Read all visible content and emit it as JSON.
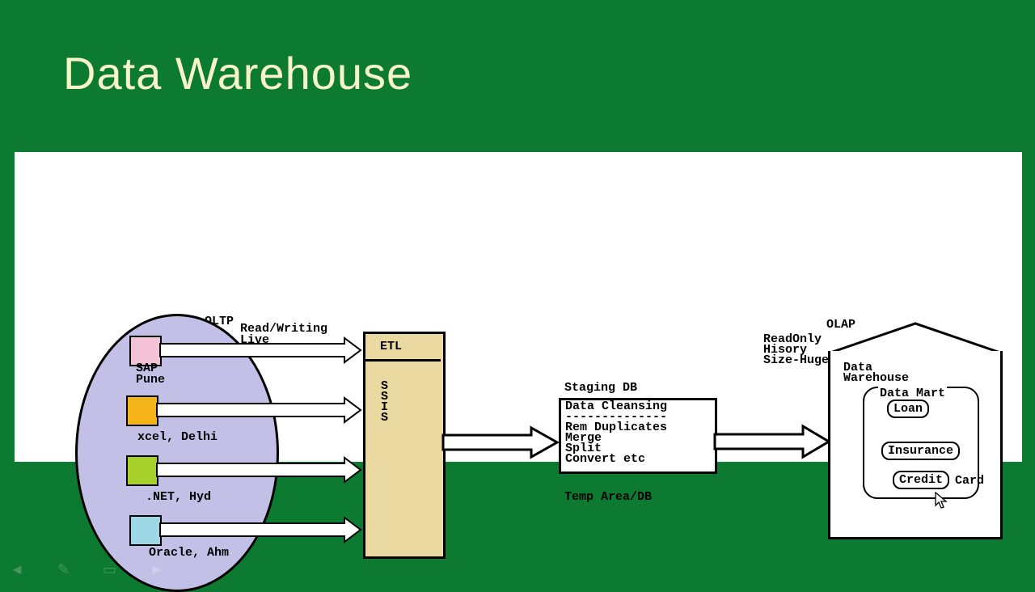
{
  "title": "Data Warehouse",
  "oltp": {
    "header": "OLTP",
    "note": "Read/Writing\nLive",
    "sources": {
      "sap": "SAP\nPune",
      "xcel": "xcel, Delhi",
      "net": ".NET, Hyd",
      "oracle": "Oracle, Ahm"
    }
  },
  "etl": {
    "header": "ETL",
    "body": "S\nS\nI\nS"
  },
  "staging": {
    "header": "Staging DB",
    "body": "Data Cleansing\n--------------\nRem Duplicates\nMerge\nSplit\nConvert etc",
    "footer": "Temp Area/DB"
  },
  "olap": {
    "header": "OLAP",
    "note": "ReadOnly\nHisory\nSize-Huge",
    "dw_label": "Data\nWarehouse",
    "dm_label": "Data Mart",
    "marts": {
      "loan": "Loan",
      "insurance": "Insurance",
      "credit": "Credit"
    },
    "credit_overflow": "Card"
  },
  "colors": {
    "bg": "#0d7a31",
    "title": "#f6f4c8",
    "ellipse": "#c2c0e6",
    "etl": "#ead9a0",
    "sap": "#f3c2d6",
    "xcel": "#f4b41a",
    "net": "#a7d12a",
    "oracle": "#9ed7e6"
  }
}
